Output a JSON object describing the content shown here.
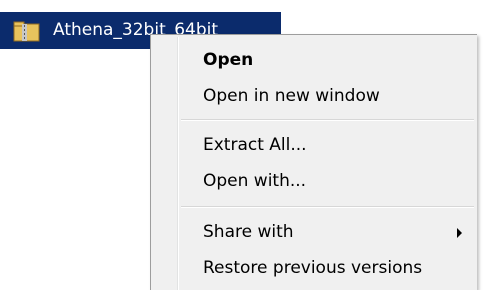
{
  "file": {
    "name": "Athena_32bit_64bit",
    "icon": "zip-folder-icon"
  },
  "menu": {
    "items": [
      {
        "label": "Open",
        "bold": true
      },
      {
        "label": "Open in new window",
        "bold": false
      },
      {
        "label": "Extract All...",
        "bold": false,
        "highlighted": true
      },
      {
        "label": "Open with...",
        "bold": false
      },
      {
        "label": "Share with",
        "bold": false,
        "submenu": true
      },
      {
        "label": "Restore previous versions",
        "bold": false
      }
    ]
  },
  "colors": {
    "selection": "#0b2b6c",
    "menu_background": "#f0f0f0",
    "highlighter": "#eef000"
  }
}
